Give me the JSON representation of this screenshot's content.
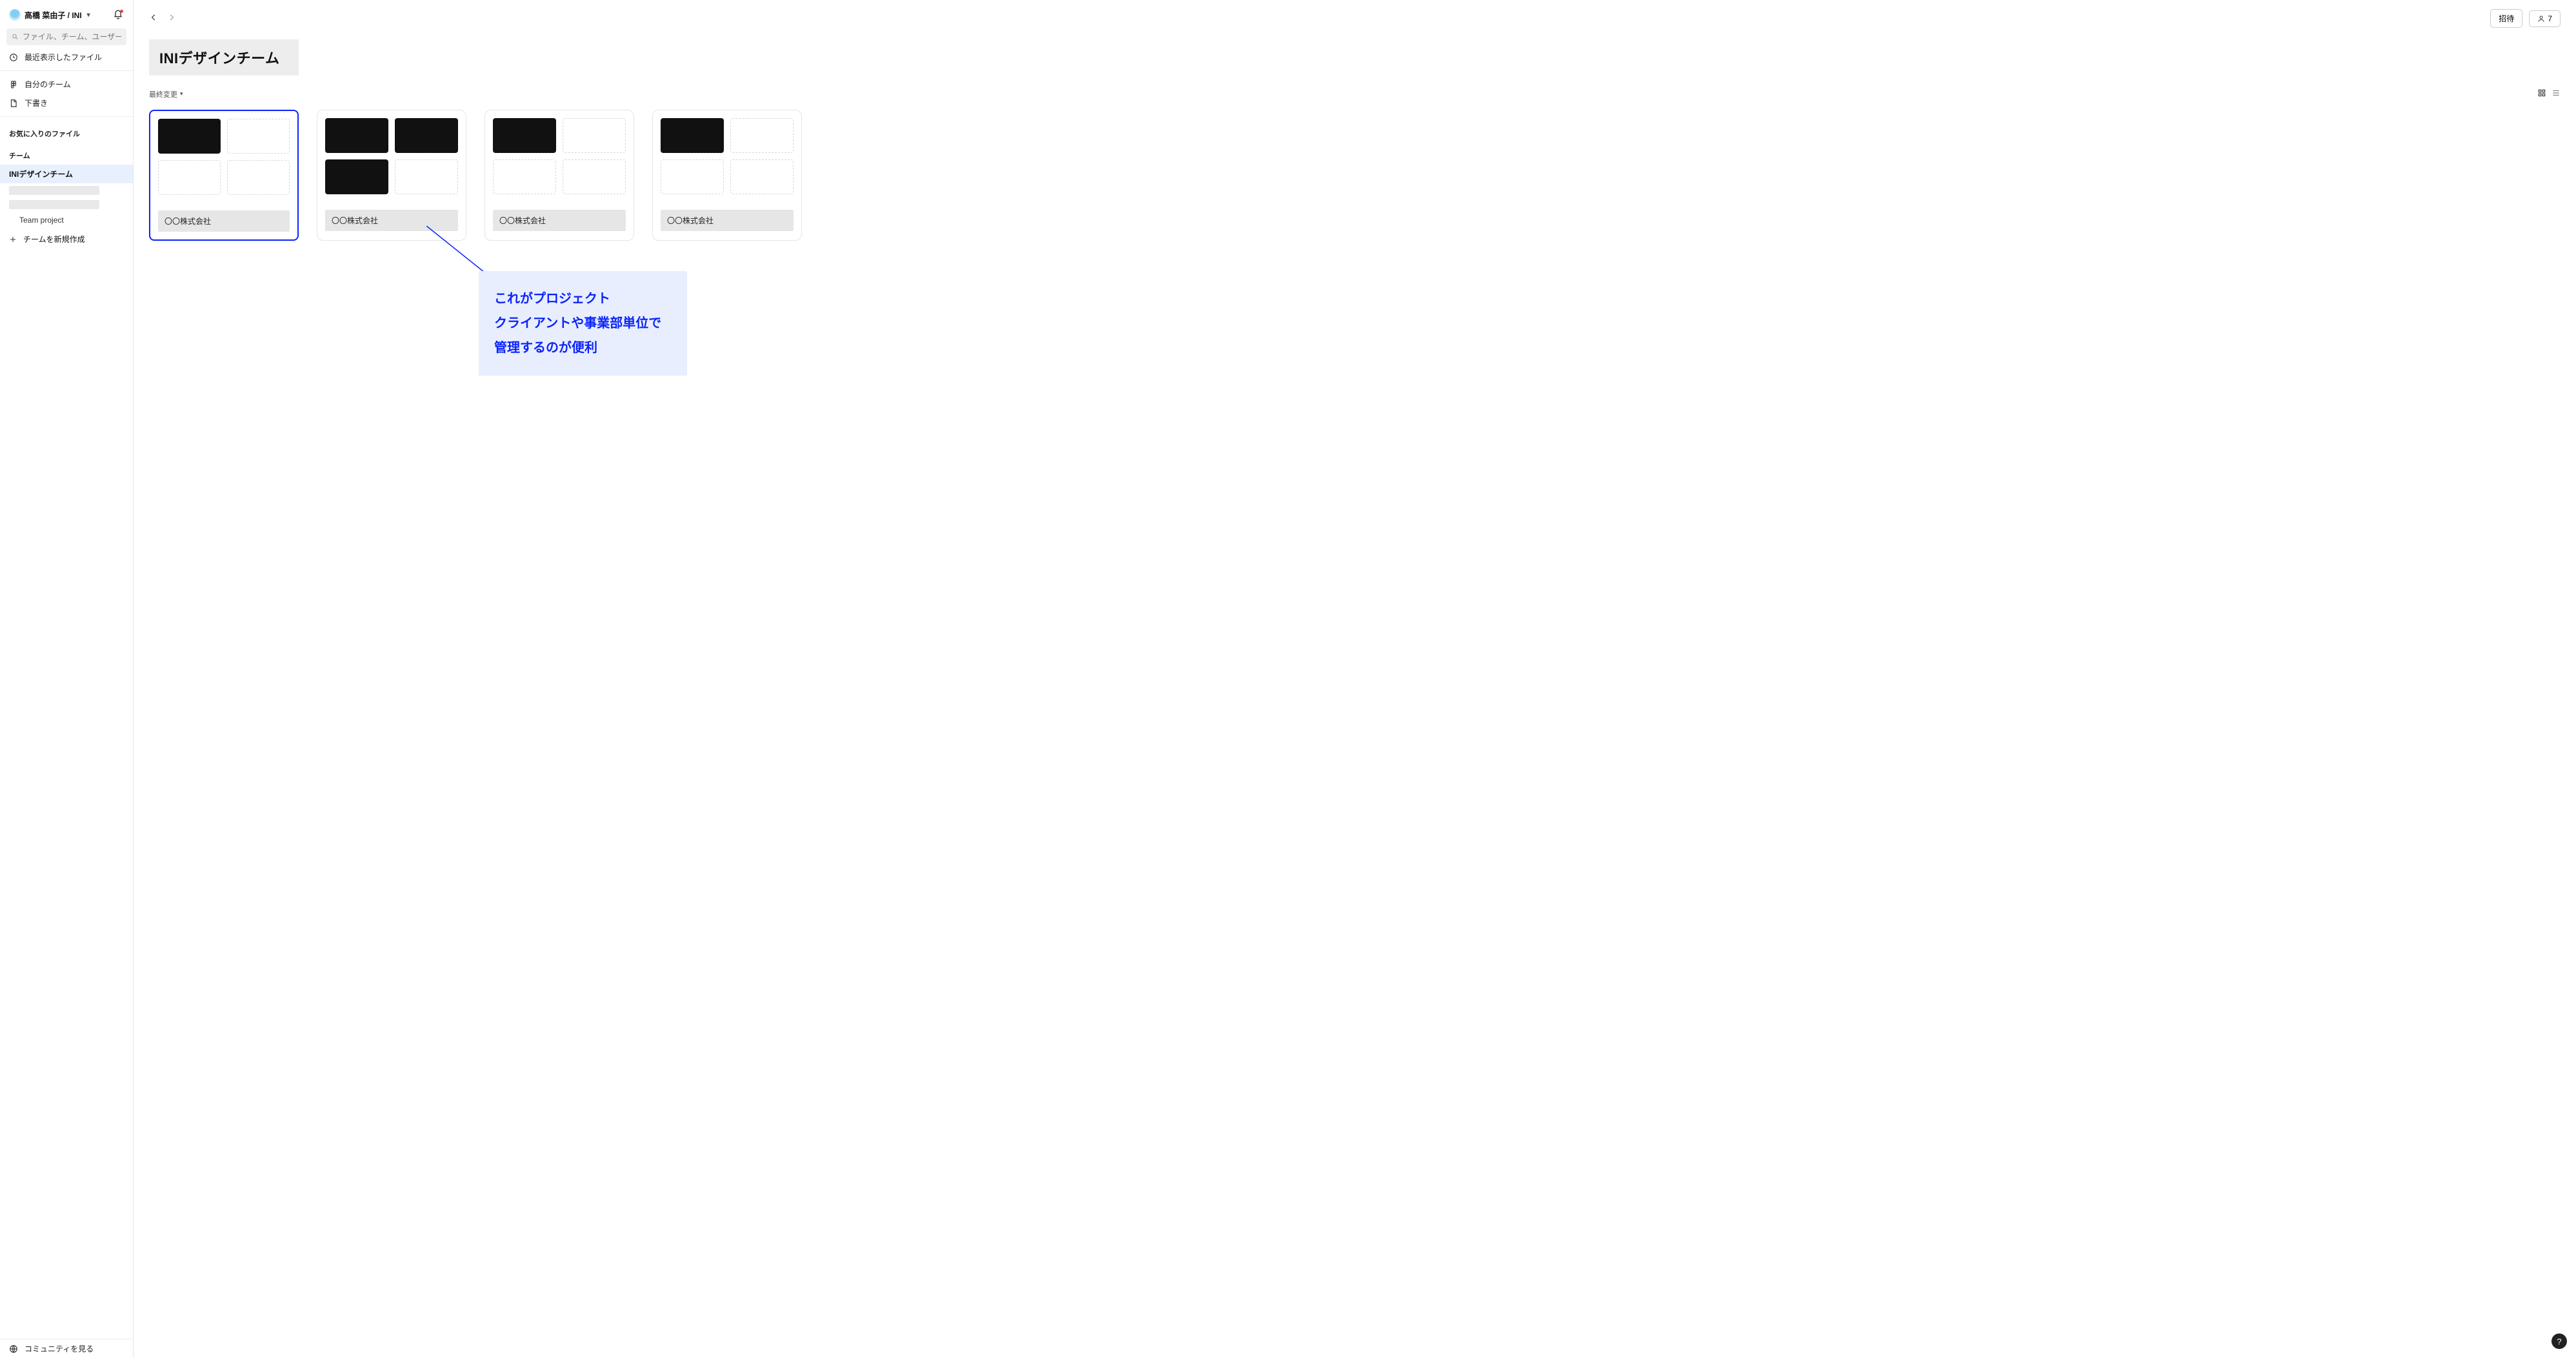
{
  "account": {
    "name": "高橋 菜由子 / INI"
  },
  "search": {
    "placeholder": "ファイル、チーム、ユーザーを検索"
  },
  "sidebar": {
    "recent": "最近表示したファイル",
    "your_teams": "自分のチーム",
    "drafts": "下書き",
    "favorites_header": "お気に入りのファイル",
    "teams_header": "チーム",
    "team_active": "INIデザインチーム",
    "team_project": "Team project",
    "create_team": "チームを新規作成",
    "community": "コミュニティを見る"
  },
  "header": {
    "title": "INIデザインチーム",
    "invite_label": "招待",
    "member_count": "7"
  },
  "filter": {
    "sort_label": "最終変更"
  },
  "projects": [
    {
      "name": "〇〇株式会社",
      "thumbs": [
        "filled",
        "empty",
        "empty",
        "empty"
      ],
      "highlighted": true
    },
    {
      "name": "〇〇株式会社",
      "thumbs": [
        "filled",
        "filled",
        "filled",
        "empty"
      ],
      "highlighted": false
    },
    {
      "name": "〇〇株式会社",
      "thumbs": [
        "filled",
        "empty",
        "empty",
        "empty"
      ],
      "highlighted": false
    },
    {
      "name": "〇〇株式会社",
      "thumbs": [
        "filled",
        "empty",
        "empty",
        "empty"
      ],
      "highlighted": false
    }
  ],
  "annotation": {
    "line1": "これがプロジェクト",
    "line2": "クライアントや事業部単位で",
    "line3": "管理するのが便利"
  },
  "help_label": "?"
}
